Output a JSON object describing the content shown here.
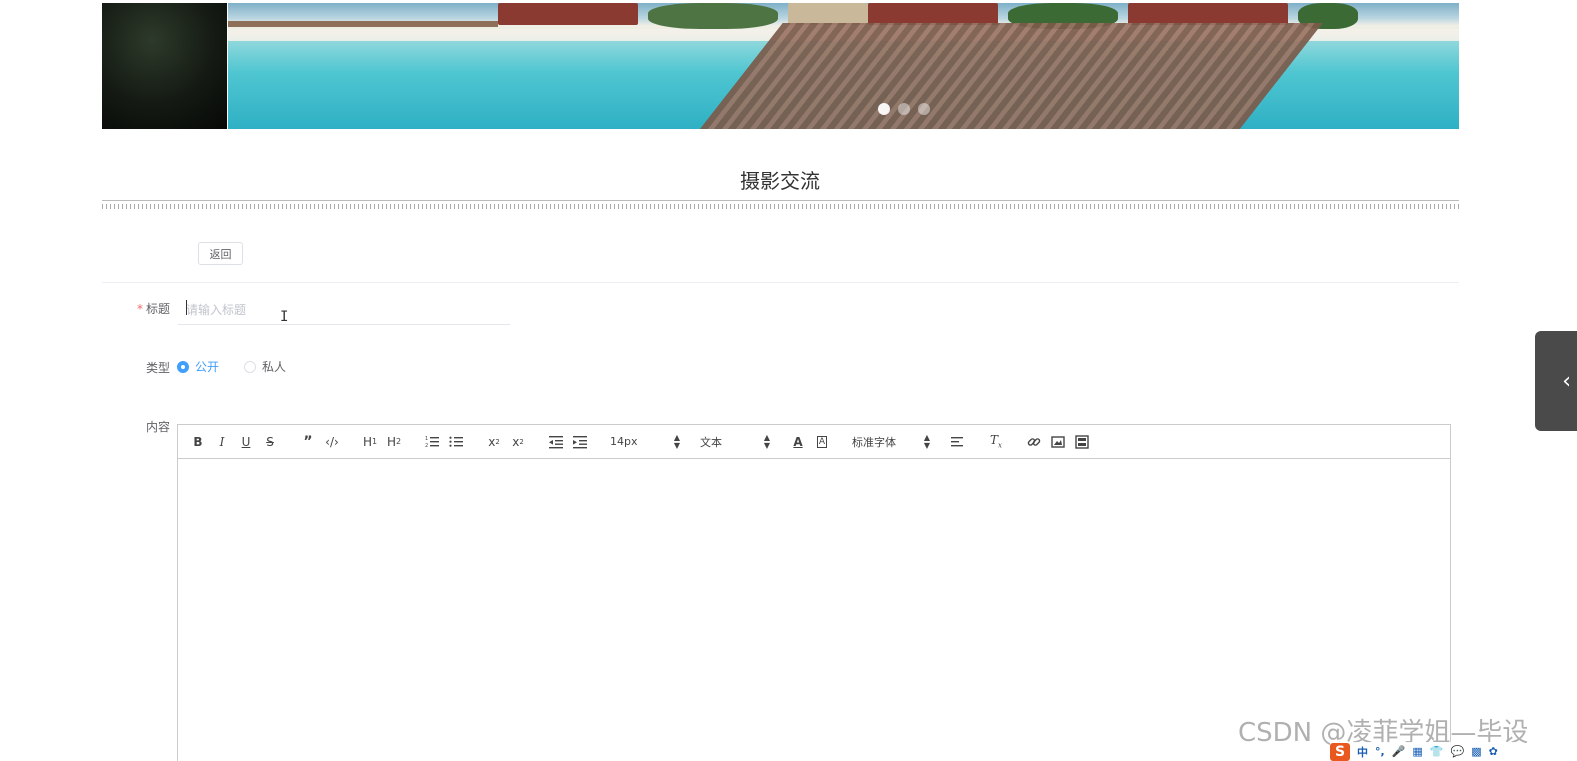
{
  "banner": {
    "slides": 3,
    "active_slide": 0
  },
  "page_title": "摄影交流",
  "back_label": "返回",
  "form": {
    "title_label": "标题",
    "title_placeholder": "请输入标题",
    "title_value": "",
    "type_label": "类型",
    "type_options": [
      "公开",
      "私人"
    ],
    "type_selected": "公开",
    "content_label": "内容"
  },
  "editor": {
    "font_size": "14px",
    "header_type": "文本",
    "font_family": "标准字体",
    "tools": [
      "bold-icon",
      "italic-icon",
      "underline-icon",
      "strike-icon",
      "blockquote-icon",
      "code-block-icon",
      "h1-icon",
      "h2-icon",
      "ordered-list-icon",
      "bullet-list-icon",
      "subscript-icon",
      "superscript-icon",
      "outdent-icon",
      "indent-icon",
      "font-color-icon",
      "background-color-icon",
      "align-icon",
      "clean-format-icon",
      "link-icon",
      "image-icon",
      "video-icon"
    ]
  },
  "watermark": "CSDN @凌菲学姐—毕设",
  "ime_glyphs": [
    "中",
    "°,",
    "🎤",
    "▦",
    "👕",
    "💬",
    "▩",
    "✿"
  ],
  "colors": {
    "primary": "#409eff",
    "required": "#f56c6c",
    "side_handle": "#4a4a4a"
  }
}
